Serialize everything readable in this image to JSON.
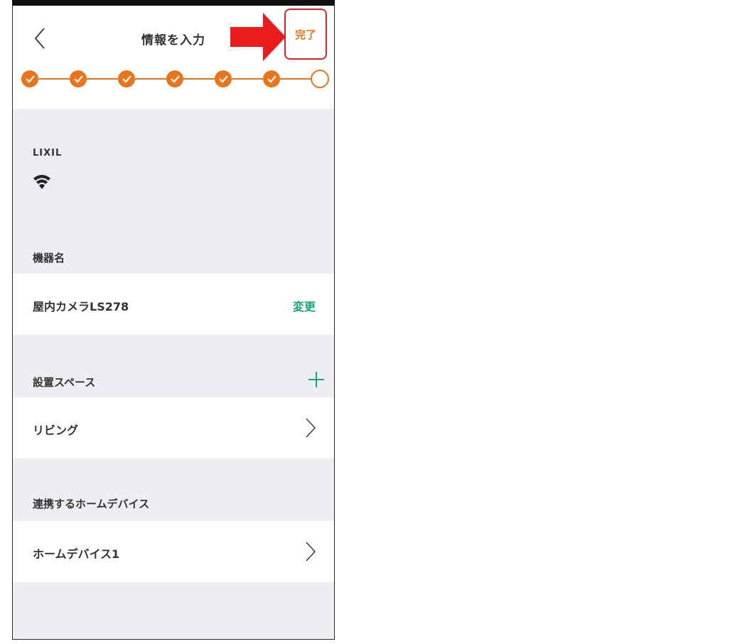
{
  "header": {
    "title": "情報を入力",
    "done_label": "完了",
    "back_icon": "chevron-left-icon"
  },
  "stepper": {
    "total_steps": 7,
    "completed_steps": 6,
    "accent_color": "#e8741c"
  },
  "device": {
    "brand": "LIXIL",
    "connection_icon": "wifi-icon"
  },
  "sections": {
    "device_name": {
      "header": "機器名",
      "value": "屋内カメラLS278",
      "action_label": "変更"
    },
    "install_space": {
      "header": "設置スペース",
      "value": "リビング",
      "add_icon": "plus-icon"
    },
    "linked_devices": {
      "header": "連携するホームデバイス",
      "value": "ホームデバイス1"
    }
  },
  "colors": {
    "accent_orange": "#e8741c",
    "green": "#1aa37a",
    "highlight_red": "#d9232a",
    "background": "#eceef1"
  }
}
